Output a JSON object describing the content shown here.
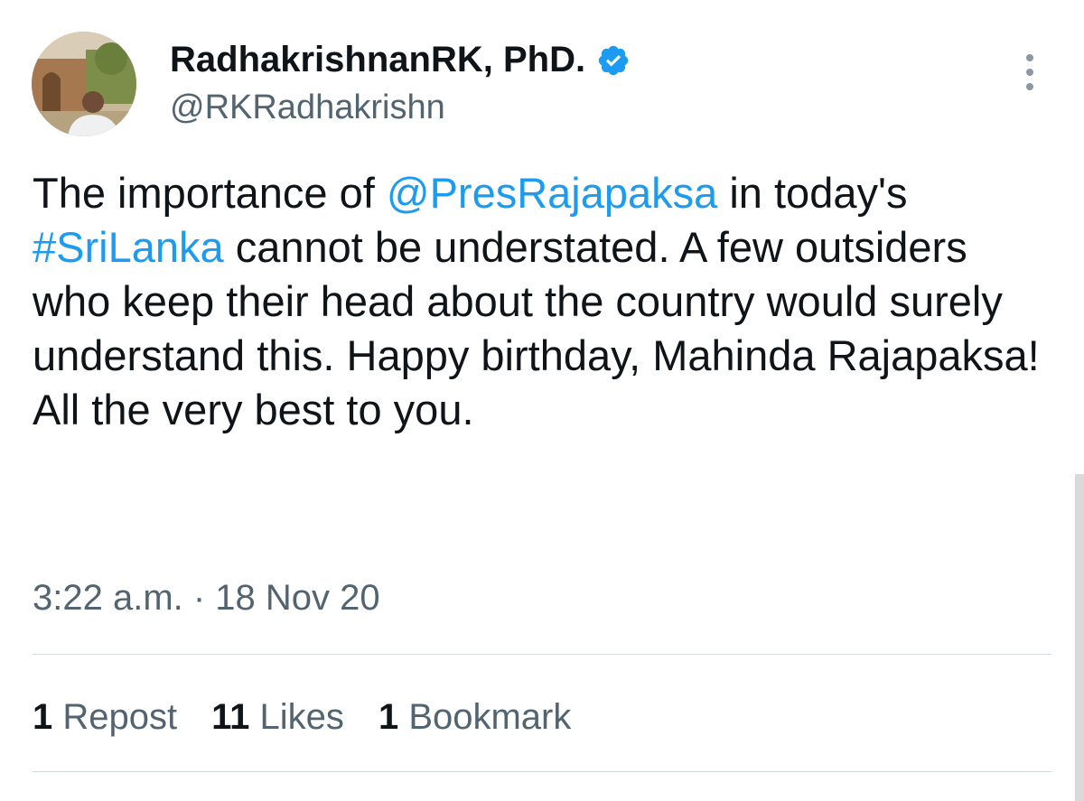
{
  "author": {
    "display_name": "RadhakrishnanRK, PhD.",
    "handle": "@RKRadhakrishn",
    "verified": true,
    "verified_color": "#1d9bf0"
  },
  "tweet": {
    "segments": [
      {
        "text": "The importance of ",
        "type": "text"
      },
      {
        "text": "@PresRajapaksa",
        "type": "mention"
      },
      {
        "text": " in today's ",
        "type": "text"
      },
      {
        "text": "#SriLanka",
        "type": "hashtag"
      },
      {
        "text": " cannot be understated. A few outsiders who keep their head about the country would surely understand this. Happy birthday, Mahinda Rajapaksa! All the very best to you.",
        "type": "text"
      }
    ],
    "timestamp": "3:22 a.m. · 18 Nov 20"
  },
  "stats": [
    {
      "count": "1",
      "label": "Repost"
    },
    {
      "count": "11",
      "label": "Likes"
    },
    {
      "count": "1",
      "label": "Bookmark"
    }
  ],
  "colors": {
    "link": "#1d9bf0",
    "text": "#0f1419",
    "secondary": "#536471",
    "divider": "#cfd9de"
  },
  "icons": {
    "more": "more-vertical-icon",
    "verified": "verified-badge-icon"
  }
}
